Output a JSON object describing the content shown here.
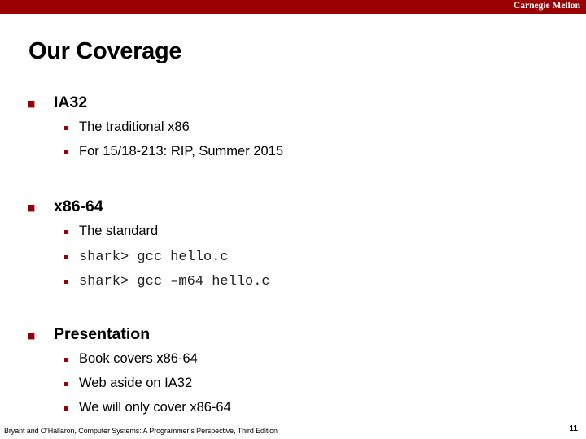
{
  "header": {
    "brand": "Carnegie Mellon",
    "bar_color": "#990000"
  },
  "slide": {
    "title": "Our Coverage",
    "sections": [
      {
        "heading": "IA32",
        "items": [
          {
            "text": "The traditional x86",
            "style": "normal"
          },
          {
            "text": "For 15/18-213: RIP, Summer 2015",
            "style": "normal"
          }
        ]
      },
      {
        "heading": "x86-64",
        "items": [
          {
            "text": "The standard",
            "style": "normal"
          },
          {
            "text": "shark> gcc hello.c",
            "style": "code"
          },
          {
            "text": "shark> gcc –m64 hello.c",
            "style": "code"
          }
        ]
      },
      {
        "heading": "Presentation",
        "items": [
          {
            "text": "Book covers x86-64",
            "style": "normal"
          },
          {
            "text": "Web aside on IA32",
            "style": "normal"
          },
          {
            "text": "We will only cover x86-64",
            "style": "normal"
          }
        ]
      }
    ]
  },
  "footer": {
    "citation": "Bryant and O’Hallaron, Computer Systems: A Programmer’s Perspective, Third Edition",
    "page_number": "11"
  }
}
